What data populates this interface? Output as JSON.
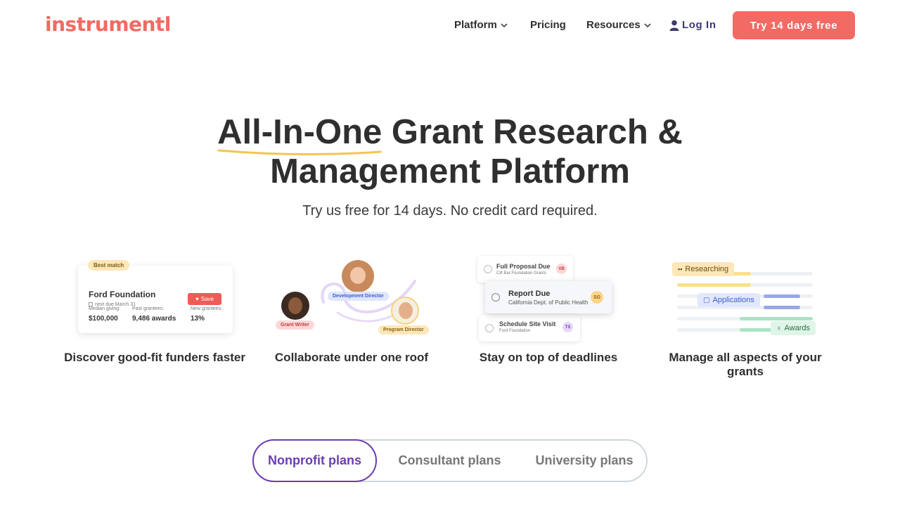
{
  "nav": {
    "logo": "instrumentl",
    "platform": "Platform",
    "pricing": "Pricing",
    "resources": "Resources",
    "login": "Log In",
    "cta": "Try 14 days free"
  },
  "hero": {
    "highlight": "All-In-One",
    "title_rest": " Grant Research &",
    "title_line2": "Management Platform",
    "subtitle": "Try us free for 14 days. No credit card required."
  },
  "features": [
    {
      "caption": "Discover good-fit funders faster",
      "badge": "Best match",
      "title": "Ford Foundation",
      "due": "next due March 31",
      "save": "Save",
      "stats": [
        {
          "label": "Median giving:",
          "value": "$100,000"
        },
        {
          "label": "Past grantees:",
          "value": "9,486 awards"
        },
        {
          "label": "New grantees:",
          "value": "13%"
        }
      ]
    },
    {
      "caption": "Collaborate under one roof",
      "roles": [
        "Development Director",
        "Grant Writer",
        "Program Director"
      ]
    },
    {
      "caption": "Stay on top of deadlines",
      "items": [
        {
          "title": "Full Proposal Due",
          "sub": "Clif Bar Foundation Grants",
          "initials": "VB"
        },
        {
          "title": "Report Due",
          "sub": "California Dept. of Public Health",
          "initials": "SG"
        },
        {
          "title": "Schedule Site Visit",
          "sub": "Ford Foundation",
          "initials": "TS"
        }
      ]
    },
    {
      "caption": "Manage all aspects of your grants",
      "tags": [
        "Researching",
        "Applications",
        "Awards"
      ]
    }
  ],
  "plans": {
    "tabs": [
      "Nonprofit plans",
      "Consultant plans",
      "University plans"
    ],
    "active": "Nonprofit plans"
  },
  "colors": {
    "brand": "#f26a63",
    "dark": "#2f2f2f",
    "purple": "#6c3db0",
    "navy": "#3d3b6e"
  }
}
